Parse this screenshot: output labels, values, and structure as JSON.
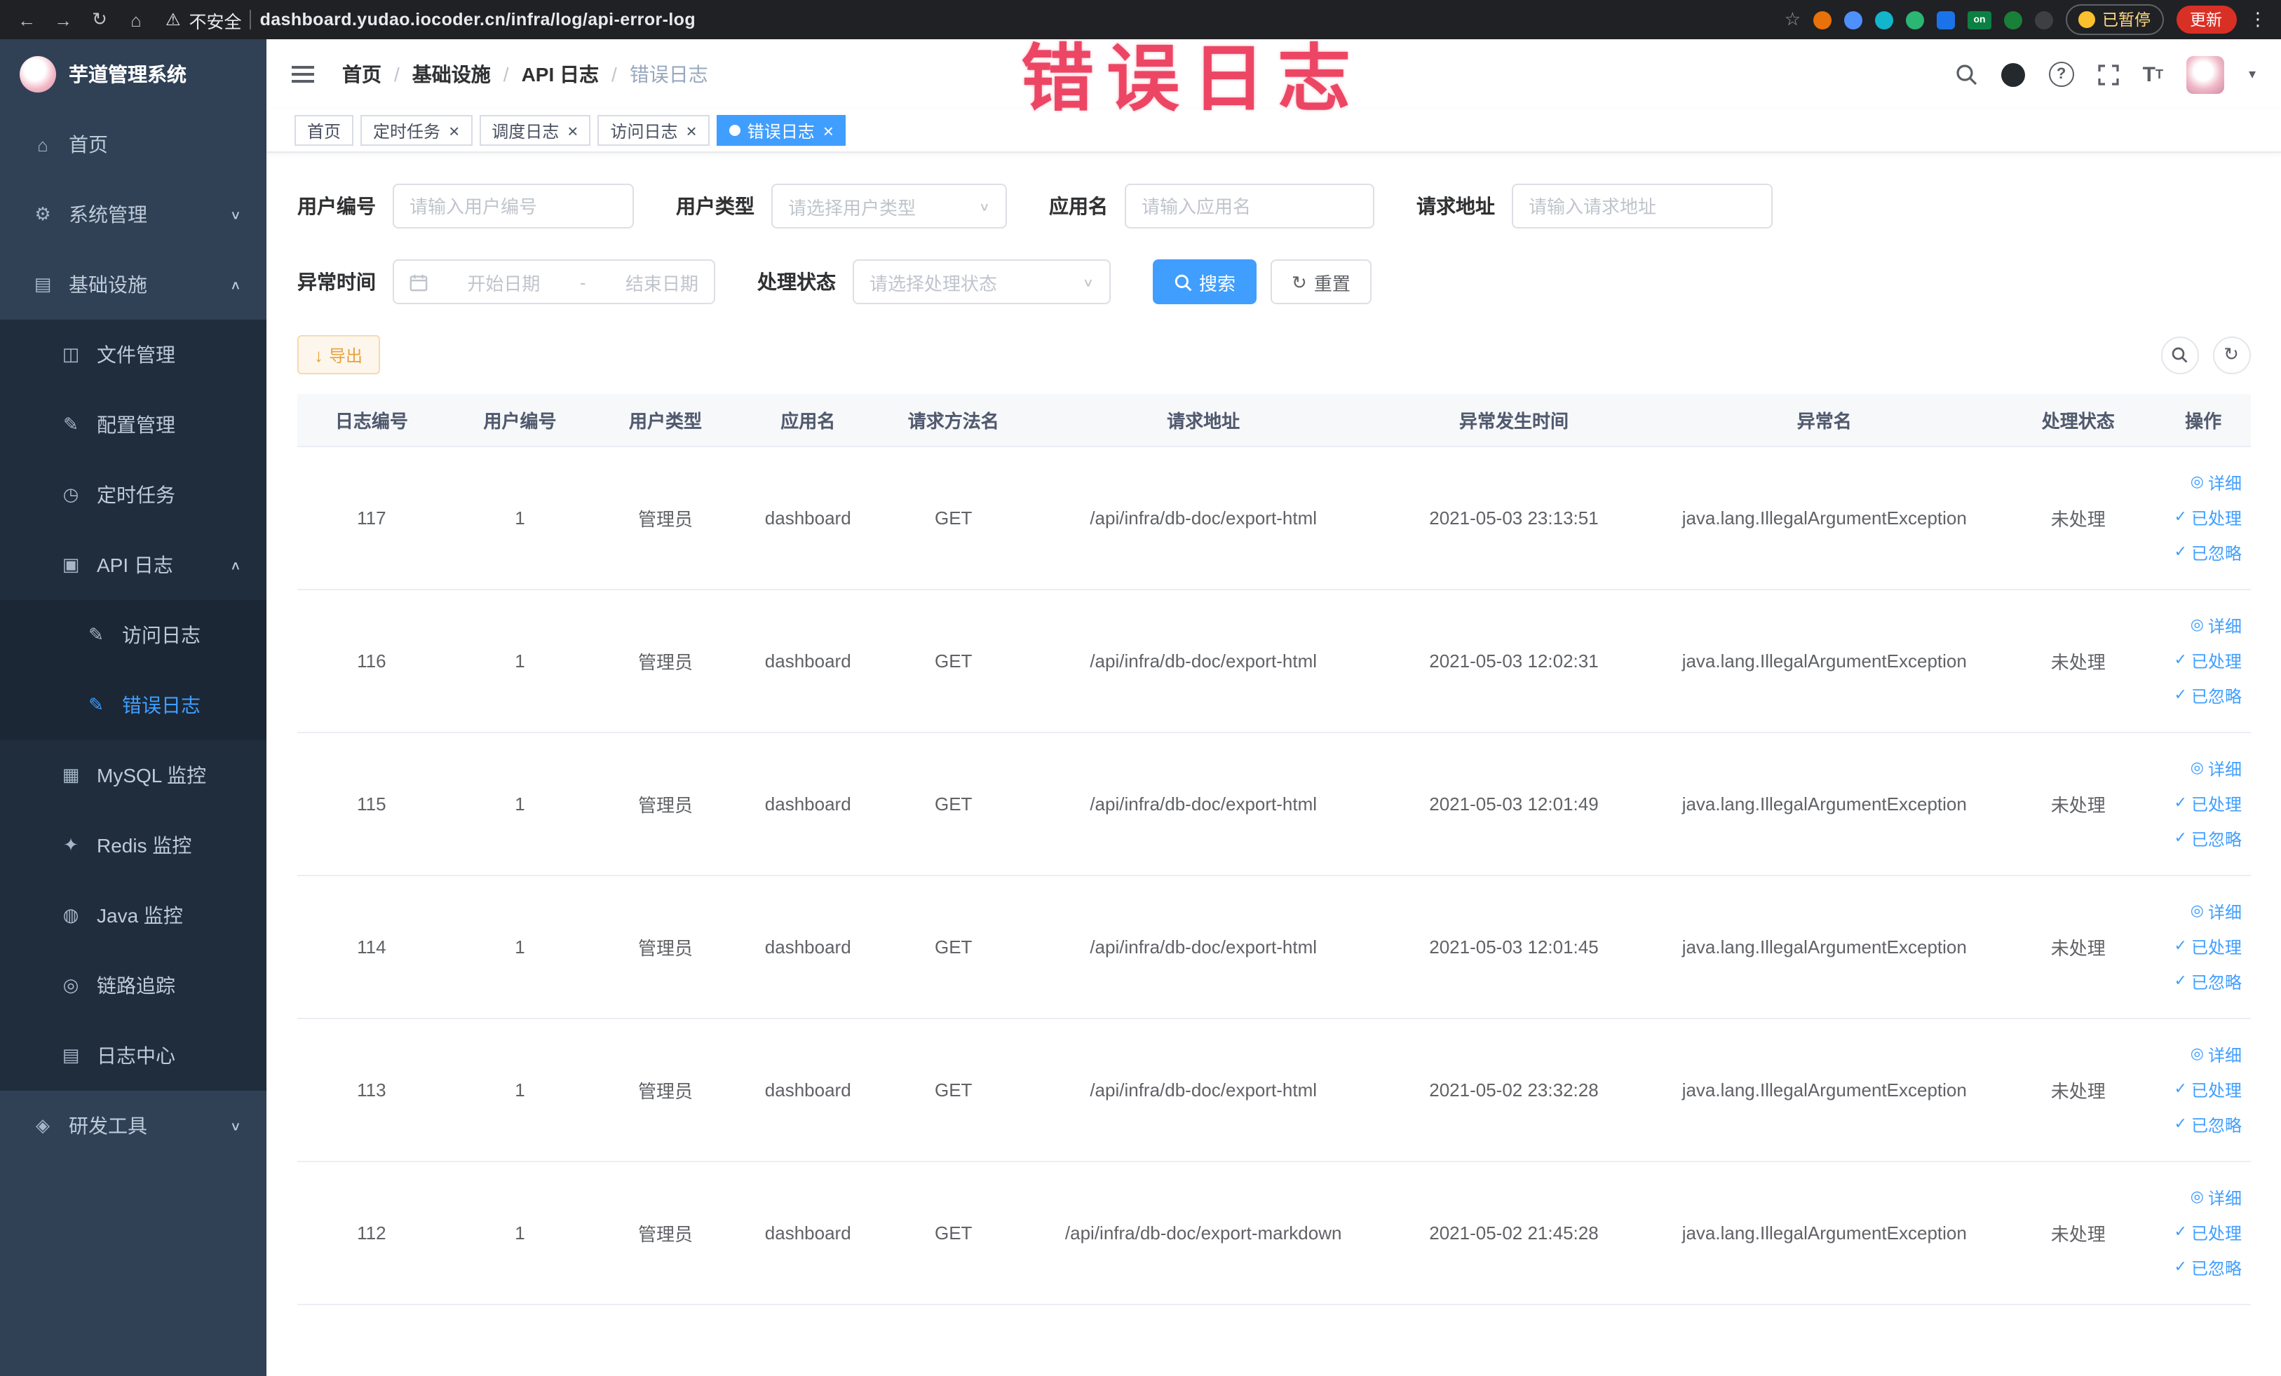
{
  "ui": {
    "icons": {
      "back": "←",
      "forward": "→",
      "refresh": "↻",
      "home": "⌂",
      "warning": "⚠",
      "star": "☆",
      "menu_dots": "⋮",
      "caret_down": "▾",
      "chevron_down": "∨",
      "chevron_up": "∧",
      "close": "×",
      "download": "↓",
      "check": "✓",
      "eye": "◎",
      "question": "?"
    },
    "colors": {
      "accent": "#409eff",
      "sidebar_bg": "#304156",
      "sidebar_sub_bg": "#1f2d3d",
      "warning_button": "#e6a23c",
      "annotation": "#ea3354",
      "update_button_bg": "#d93025"
    }
  },
  "browser": {
    "security_label": "不安全",
    "url": "dashboard.yudao.iocoder.cn/infra/log/api-error-log",
    "extension_badge": "on",
    "paused_button": "已暂停",
    "update_button": "更新"
  },
  "annotation": {
    "overlay_text": "错误日志"
  },
  "sidebar": {
    "logo_title": "芋道管理系统",
    "items": [
      {
        "label": "首页",
        "icon_glyph": "⌂"
      },
      {
        "label": "系统管理",
        "icon_glyph": "⚙"
      },
      {
        "label": "基础设施",
        "icon_glyph": "▤"
      },
      {
        "label": "文件管理",
        "icon_glyph": "◫"
      },
      {
        "label": "配置管理",
        "icon_glyph": "✎"
      },
      {
        "label": "定时任务",
        "icon_glyph": "◷"
      },
      {
        "label": "API 日志",
        "icon_glyph": "▣"
      },
      {
        "label": "访问日志",
        "icon_glyph": "✎"
      },
      {
        "label": "错误日志",
        "icon_glyph": "✎"
      },
      {
        "label": "MySQL 监控",
        "icon_glyph": "▦"
      },
      {
        "label": "Redis 监控",
        "icon_glyph": "✦"
      },
      {
        "label": "Java 监控",
        "icon_glyph": "◍"
      },
      {
        "label": "链路追踪",
        "icon_glyph": "◎"
      },
      {
        "label": "日志中心",
        "icon_glyph": "▤"
      },
      {
        "label": "研发工具",
        "icon_glyph": "◈"
      }
    ]
  },
  "header": {
    "breadcrumb": [
      "首页",
      "基础设施",
      "API 日志",
      "错误日志"
    ]
  },
  "tabs": [
    {
      "label": "首页"
    },
    {
      "label": "定时任务"
    },
    {
      "label": "调度日志"
    },
    {
      "label": "访问日志"
    },
    {
      "label": "错误日志"
    }
  ],
  "filters": {
    "user_id_label": "用户编号",
    "user_id_placeholder": "请输入用户编号",
    "user_type_label": "用户类型",
    "user_type_placeholder": "请选择用户类型",
    "app_name_label": "应用名",
    "app_name_placeholder": "请输入应用名",
    "request_url_label": "请求地址",
    "request_url_placeholder": "请输入请求地址",
    "exception_time_label": "异常时间",
    "start_date_placeholder": "开始日期",
    "range_separator": "-",
    "end_date_placeholder": "结束日期",
    "process_status_label": "处理状态",
    "process_status_placeholder": "请选择处理状态",
    "search_button": "搜索",
    "reset_button": "重置"
  },
  "toolbar": {
    "export_button": "导出"
  },
  "table": {
    "columns": [
      "日志编号",
      "用户编号",
      "用户类型",
      "应用名",
      "请求方法名",
      "请求地址",
      "异常发生时间",
      "异常名",
      "处理状态",
      "操作"
    ],
    "actions": [
      {
        "label": "详细"
      },
      {
        "label": "已处理"
      },
      {
        "label": "已忽略"
      }
    ],
    "rows": [
      {
        "log_id": "117",
        "user_id": "1",
        "user_type": "管理员",
        "app_name": "dashboard",
        "method": "GET",
        "request_url": "/api/infra/db-doc/export-html",
        "time": "2021-05-03 23:13:51",
        "exception": "java.lang.IllegalArgumentException",
        "status": "未处理"
      },
      {
        "log_id": "116",
        "user_id": "1",
        "user_type": "管理员",
        "app_name": "dashboard",
        "method": "GET",
        "request_url": "/api/infra/db-doc/export-html",
        "time": "2021-05-03 12:02:31",
        "exception": "java.lang.IllegalArgumentException",
        "status": "未处理"
      },
      {
        "log_id": "115",
        "user_id": "1",
        "user_type": "管理员",
        "app_name": "dashboard",
        "method": "GET",
        "request_url": "/api/infra/db-doc/export-html",
        "time": "2021-05-03 12:01:49",
        "exception": "java.lang.IllegalArgumentException",
        "status": "未处理"
      },
      {
        "log_id": "114",
        "user_id": "1",
        "user_type": "管理员",
        "app_name": "dashboard",
        "method": "GET",
        "request_url": "/api/infra/db-doc/export-html",
        "time": "2021-05-03 12:01:45",
        "exception": "java.lang.IllegalArgumentException",
        "status": "未处理"
      },
      {
        "log_id": "113",
        "user_id": "1",
        "user_type": "管理员",
        "app_name": "dashboard",
        "method": "GET",
        "request_url": "/api/infra/db-doc/export-html",
        "time": "2021-05-02 23:32:28",
        "exception": "java.lang.IllegalArgumentException",
        "status": "未处理"
      },
      {
        "log_id": "112",
        "user_id": "1",
        "user_type": "管理员",
        "app_name": "dashboard",
        "method": "GET",
        "request_url": "/api/infra/db-doc/export-markdown",
        "time": "2021-05-02 21:45:28",
        "exception": "java.lang.IllegalArgumentException",
        "status": "未处理"
      }
    ]
  }
}
